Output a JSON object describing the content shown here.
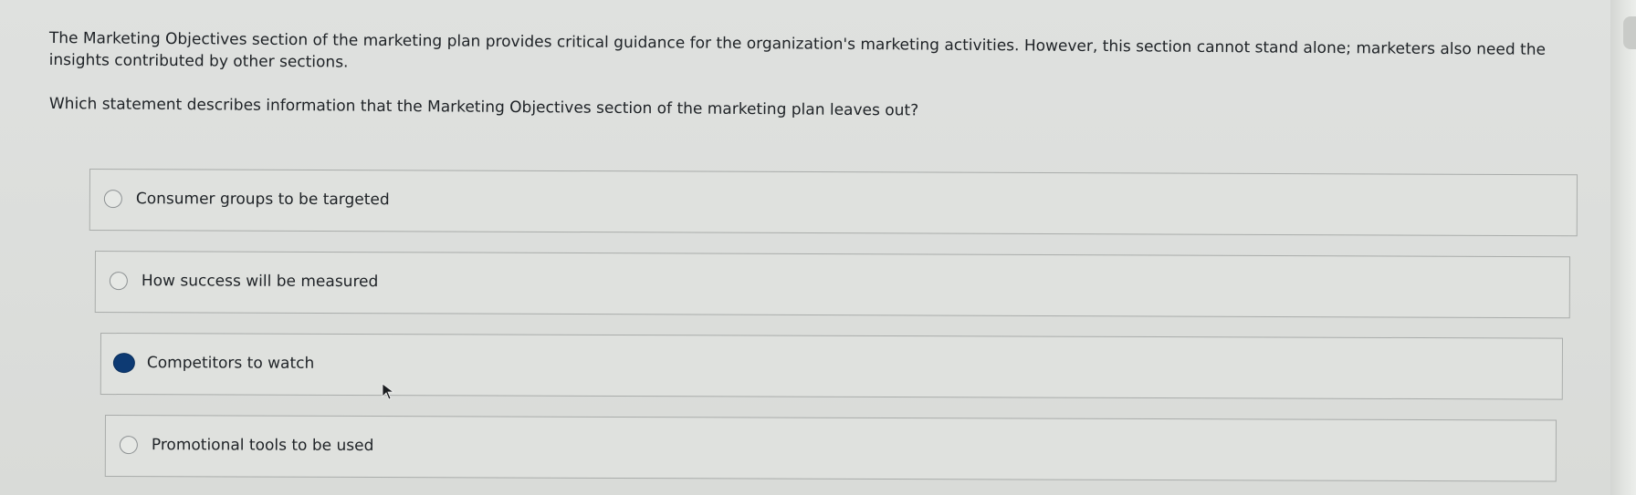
{
  "question": {
    "stem": "The Marketing Objectives section of the marketing plan provides critical guidance for the organization's marketing activities. However, this section cannot stand alone; marketers also need the insights contributed by other sections.",
    "prompt": "Which statement describes information that the Marketing Objectives section of the marketing plan leaves out?"
  },
  "choices": [
    {
      "label": "Consumer groups to be targeted",
      "selected": false
    },
    {
      "label": "How success will be measured",
      "selected": false
    },
    {
      "label": "Competitors to watch",
      "selected": true
    },
    {
      "label": "Promotional tools to be used",
      "selected": false
    }
  ],
  "colors": {
    "background": "#dcdedb",
    "selected_radio": "#0d3a73",
    "border": "#a9acaa"
  },
  "icons": {
    "cursor": "mouse-pointer-icon",
    "radio": "radio-button-icon"
  }
}
